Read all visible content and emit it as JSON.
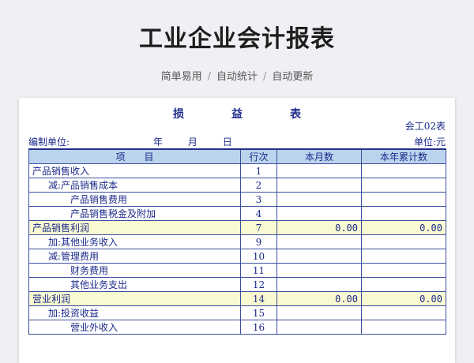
{
  "header": {
    "title": "工业企业会计报表",
    "subtitle": [
      "简单易用",
      "自动统计",
      "自动更新"
    ],
    "separator": "/"
  },
  "sheet": {
    "title": "损益表",
    "form_code": "会工02表",
    "unit_label": "编制单位:",
    "date_labels": [
      "年",
      "月",
      "日"
    ],
    "currency_label": "单位:元",
    "columns": [
      "项　　目",
      "行次",
      "本月数",
      "本年累计数"
    ],
    "rows": [
      {
        "prefix": "",
        "label": "产品销售收入",
        "line": "1",
        "month": "",
        "year": ""
      },
      {
        "prefix": "减:",
        "label": "产品销售成本",
        "line": "2",
        "month": "",
        "year": ""
      },
      {
        "prefix": "",
        "label": "产品销售费用",
        "line": "3",
        "month": "",
        "year": ""
      },
      {
        "prefix": "",
        "label": "产品销售税金及附加",
        "line": "4",
        "month": "",
        "year": ""
      },
      {
        "prefix": "",
        "label": "产品销售利润",
        "line": "7",
        "month": "0.00",
        "year": "0.00"
      },
      {
        "prefix": "加:",
        "label": "其他业务收入",
        "line": "9",
        "month": "",
        "year": ""
      },
      {
        "prefix": "减:",
        "label": "管理费用",
        "line": "10",
        "month": "",
        "year": ""
      },
      {
        "prefix": "",
        "label": "财务费用",
        "line": "11",
        "month": "",
        "year": ""
      },
      {
        "prefix": "",
        "label": "其他业务支出",
        "line": "12",
        "month": "",
        "year": ""
      },
      {
        "prefix": "",
        "label": "营业利润",
        "line": "14",
        "month": "0.00",
        "year": "0.00"
      },
      {
        "prefix": "加:",
        "label": "投资收益",
        "line": "15",
        "month": "",
        "year": ""
      },
      {
        "prefix": "",
        "label": "营业外收入",
        "line": "16",
        "month": "",
        "year": ""
      }
    ]
  }
}
